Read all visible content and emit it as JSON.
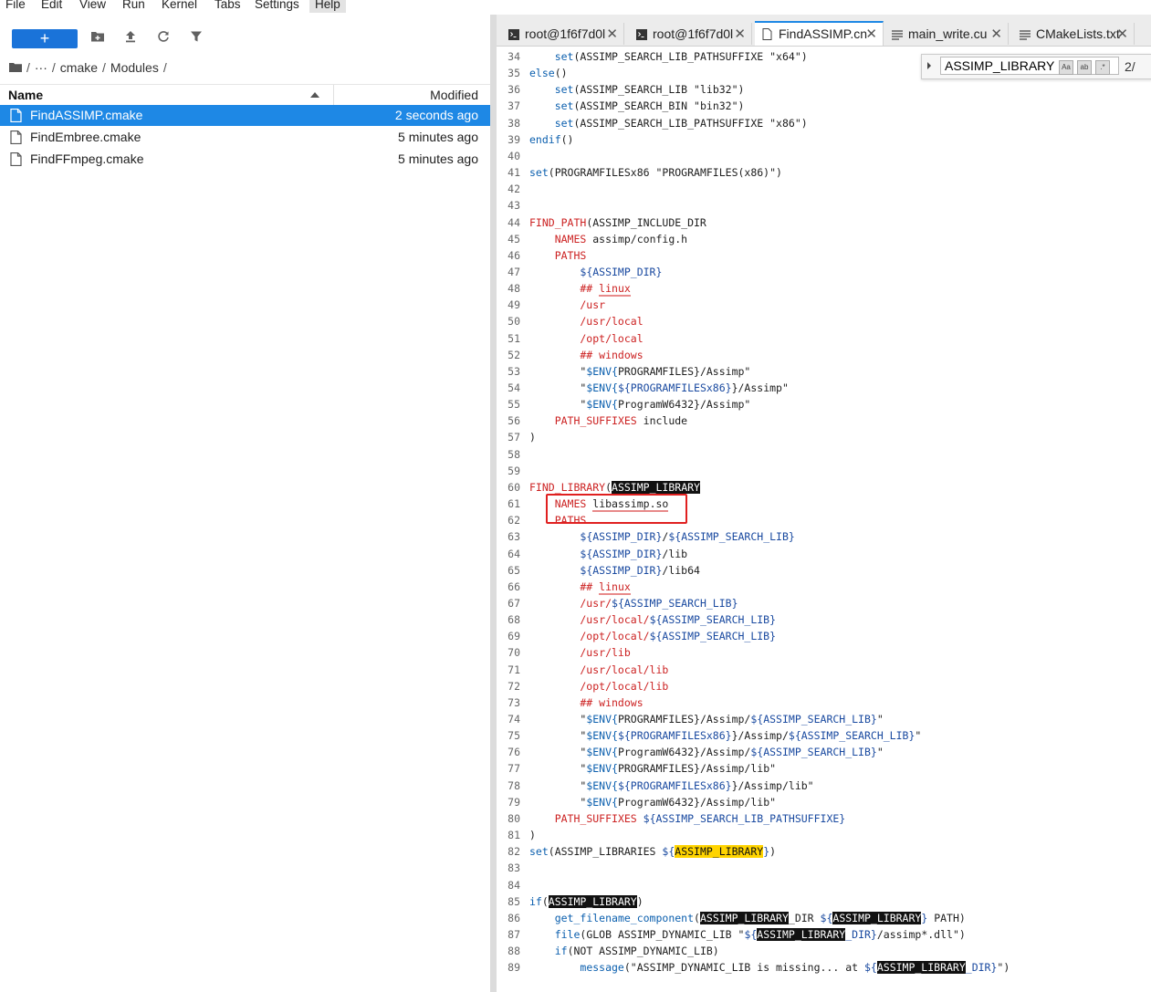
{
  "menu": [
    "File",
    "Edit",
    "View",
    "Run",
    "Kernel",
    "Tabs",
    "Settings",
    "Help"
  ],
  "browser": {
    "new_label": "+",
    "breadcrumb": [
      "/",
      "···",
      "/",
      "cmake",
      "/",
      "Modules",
      "/"
    ],
    "col_name": "Name",
    "col_modified": "Modified",
    "files": [
      {
        "name": "FindASSIMP.cmake",
        "modified": "2 seconds ago",
        "selected": true
      },
      {
        "name": "FindEmbree.cmake",
        "modified": "5 minutes ago",
        "selected": false
      },
      {
        "name": "FindFFmpeg.cmake",
        "modified": "5 minutes ago",
        "selected": false
      }
    ]
  },
  "tabs": [
    {
      "label": "root@1f6f7d0l",
      "icon": "terminal-icon"
    },
    {
      "label": "root@1f6f7d0l",
      "icon": "terminal-icon"
    },
    {
      "label": "FindASSIMP.cn",
      "icon": "file-icon",
      "active": true
    },
    {
      "label": "main_write.cu",
      "icon": "text-file-icon"
    },
    {
      "label": "CMakeLists.txt",
      "icon": "text-file-icon"
    }
  ],
  "find": {
    "value": "ASSIMP_LIBRARY",
    "count": "2/",
    "opt1": "Aa",
    "opt2": "ab",
    "opt3": ".*"
  },
  "code_first_line": 34,
  "code": [
    "    set(ASSIMP_SEARCH_LIB_PATHSUFFIXE \"x64\")",
    "else()",
    "    set(ASSIMP_SEARCH_LIB \"lib32\")",
    "    set(ASSIMP_SEARCH_BIN \"bin32\")",
    "    set(ASSIMP_SEARCH_LIB_PATHSUFFIXE \"x86\")",
    "endif()",
    "",
    "set(PROGRAMFILESx86 \"PROGRAMFILES(x86)\")",
    "",
    "",
    "FIND_PATH(ASSIMP_INCLUDE_DIR",
    "    NAMES assimp/config.h",
    "    PATHS",
    "        ${ASSIMP_DIR}",
    "        ## linux",
    "        /usr",
    "        /usr/local",
    "        /opt/local",
    "        ## windows",
    "        \"$ENV{PROGRAMFILES}/Assimp\"",
    "        \"$ENV{${PROGRAMFILESx86}}/Assimp\"",
    "        \"$ENV{ProgramW6432}/Assimp\"",
    "    PATH_SUFFIXES include",
    ")",
    "",
    "",
    "FIND_LIBRARY(ASSIMP_LIBRARY",
    "    NAMES libassimp.so",
    "    PATHS",
    "        ${ASSIMP_DIR}/${ASSIMP_SEARCH_LIB}",
    "        ${ASSIMP_DIR}/lib",
    "        ${ASSIMP_DIR}/lib64",
    "        ## linux",
    "        /usr/${ASSIMP_SEARCH_LIB}",
    "        /usr/local/${ASSIMP_SEARCH_LIB}",
    "        /opt/local/${ASSIMP_SEARCH_LIB}",
    "        /usr/lib",
    "        /usr/local/lib",
    "        /opt/local/lib",
    "        ## windows",
    "        \"$ENV{PROGRAMFILES}/Assimp/${ASSIMP_SEARCH_LIB}\"",
    "        \"$ENV{${PROGRAMFILESx86}}/Assimp/${ASSIMP_SEARCH_LIB}\"",
    "        \"$ENV{ProgramW6432}/Assimp/${ASSIMP_SEARCH_LIB}\"",
    "        \"$ENV{PROGRAMFILES}/Assimp/lib\"",
    "        \"$ENV{${PROGRAMFILESx86}}/Assimp/lib\"",
    "        \"$ENV{ProgramW6432}/Assimp/lib\"",
    "    PATH_SUFFIXES ${ASSIMP_SEARCH_LIB_PATHSUFFIXE}",
    ")",
    "set(ASSIMP_LIBRARIES ${ASSIMP_LIBRARY})",
    "",
    "",
    "if(ASSIMP_LIBRARY)",
    "    get_filename_component(ASSIMP_LIBRARY_DIR ${ASSIMP_LIBRARY} PATH)",
    "    file(GLOB ASSIMP_DYNAMIC_LIB \"${ASSIMP_LIBRARY_DIR}/assimp*.dll\")",
    "    if(NOT ASSIMP_DYNAMIC_LIB)",
    "        message(\"ASSIMP_DYNAMIC_LIB is missing... at ${ASSIMP_LIBRARY_DIR}\")"
  ],
  "colors": {
    "accent": "#1e88e5",
    "highlight_current": "#ffd400",
    "highlight_match": "#111111",
    "annotation": "#e02020"
  }
}
